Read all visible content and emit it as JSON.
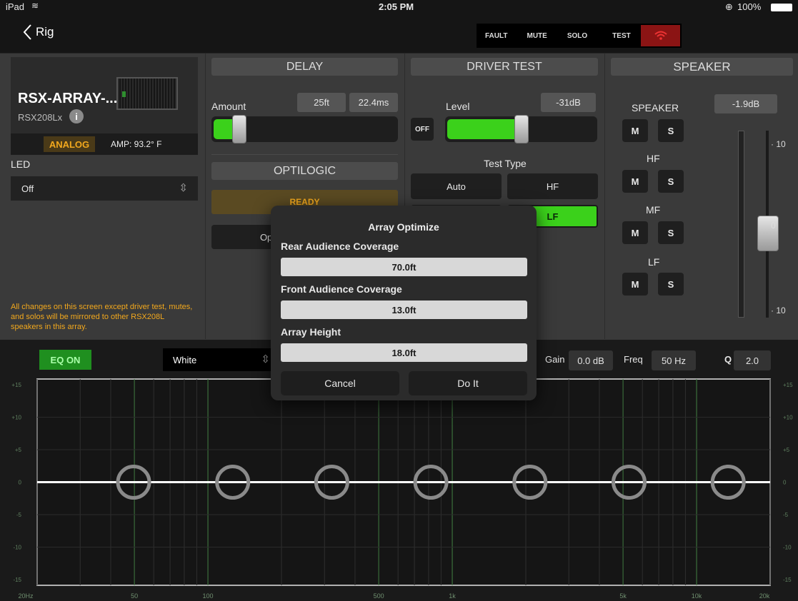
{
  "status": {
    "device": "iPad",
    "time": "2:05 PM",
    "battery": "100%"
  },
  "nav": {
    "back_label": "Rig",
    "status_buttons": [
      "FAULT",
      "MUTE",
      "SOLO",
      "TEST"
    ]
  },
  "device_panel": {
    "name": "RSX-ARRAY-...",
    "model": "RSX208Lx",
    "input_mode": "ANALOG",
    "amp_temp": "AMP: 93.2° F",
    "led_label": "LED",
    "led_value": "Off",
    "notice": "All changes on this screen except driver test, mutes, and solos will be mirrored to other RSX208L speakers in this array."
  },
  "delay": {
    "title": "DELAY",
    "amount_label": "Amount",
    "distance": "25ft",
    "time": "22.4ms",
    "level_fraction": 0.15
  },
  "optilogic": {
    "title": "OPTILOGIC",
    "status": "READY",
    "optimize_label": "Optimiz"
  },
  "driver_test": {
    "title": "DRIVER TEST",
    "off_label": "OFF",
    "level_label": "Level",
    "level_value": "-31dB",
    "level_fraction": 0.5,
    "test_type_label": "Test Type",
    "options": [
      "Auto",
      "HF",
      "LF"
    ],
    "selected": "LF"
  },
  "speaker": {
    "title": "SPEAKER",
    "gain_value": "-1.9dB",
    "groups": [
      "SPEAKER",
      "HF",
      "MF",
      "LF"
    ],
    "mute_label": "M",
    "solo_label": "S",
    "scale": [
      "10",
      "0",
      "10"
    ],
    "gain_fraction": 0.55
  },
  "eq": {
    "eq_on_label": "EQ ON",
    "preset": "White",
    "gain_label": "Gain",
    "gain_value": "0.0 dB",
    "freq_label": "Freq",
    "freq_value": "50 Hz",
    "q_label": "Q",
    "q_value": "2.0",
    "y_ticks": [
      "+15",
      "+10",
      "+5",
      "0",
      "-5",
      "-10",
      "-15"
    ],
    "x_ticks": [
      "20Hz",
      "50",
      "100",
      "500",
      "1k",
      "5k",
      "10k",
      "20k"
    ],
    "band_count": 7
  },
  "modal": {
    "title": "Array Optimize",
    "rear_label": "Rear Audience Coverage",
    "rear_value": "70.0ft",
    "front_label": "Front Audience Coverage",
    "front_value": "13.0ft",
    "height_label": "Array Height",
    "height_value": "18.0ft",
    "cancel_label": "Cancel",
    "doit_label": "Do It"
  },
  "colors": {
    "accent_green": "#3bd11b",
    "amber": "#f2a81d",
    "fault_red": "#8b1414"
  }
}
